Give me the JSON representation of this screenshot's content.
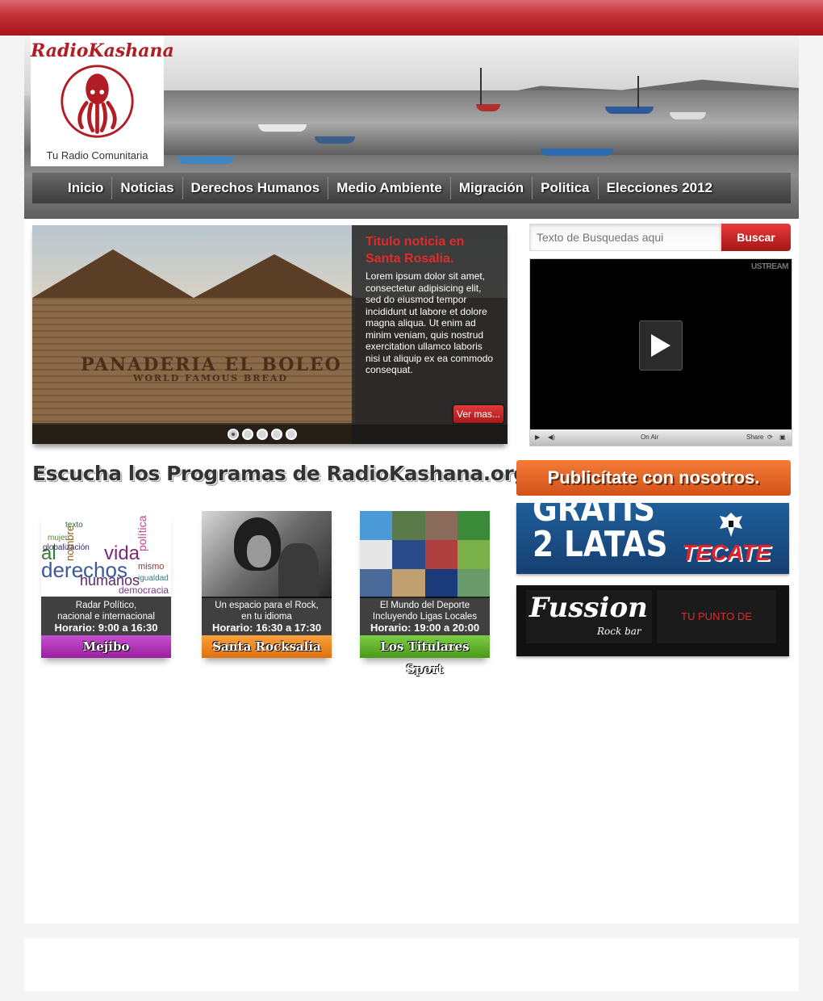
{
  "logo": {
    "title": "RadioKashana",
    "subtitle": "Tu Radio Comunitaria"
  },
  "nav": {
    "items": [
      {
        "label": "Inicio"
      },
      {
        "label": "Noticias"
      },
      {
        "label": "Derechos Humanos"
      },
      {
        "label": "Medio Ambiente"
      },
      {
        "label": "Migración"
      },
      {
        "label": "Politica"
      },
      {
        "label": "Elecciones 2012"
      }
    ]
  },
  "slider": {
    "title": "Titulo noticia en Santa Rosalia.",
    "text": "Lorem ipsum dolor sit amet, consectetur adipisicing elit, sed do eiusmod tempor incididunt ut labore et dolore magna aliqua. Ut enim ad minim veniam, quis nostrud exercitation ullamco laboris nisi ut aliquip ex ea commodo consequat.",
    "more_label": "Ver mas...",
    "photo_sign": "PANADERIA EL BOLEO",
    "photo_sign2": "WORLD FAMOUS BREAD",
    "dots": 5,
    "active_dot": 0
  },
  "search": {
    "placeholder": "Texto de Busquedas aqui",
    "button_label": "Buscar"
  },
  "player": {
    "brand": "USTREAM",
    "status": "On Air",
    "share_label": "Share"
  },
  "programs": {
    "heading": "Escucha los Programas de RadioKashana.org",
    "items": [
      {
        "line1": "Radar Político,",
        "line2": "nacional e internacional",
        "schedule": "Horario: 9:00 a 16:30",
        "label": "Mejibo",
        "color": "#b52fb8"
      },
      {
        "line1": "Un espacio para el Rock,",
        "line2": "en tu idioma",
        "schedule": "Horario: 16:30 a 17:30",
        "label": "Santa Rocksalia",
        "color": "#f08a1c"
      },
      {
        "line1": "El Mundo del Deporte",
        "line2": "Incluyendo Ligas Locales",
        "schedule": "Horario: 19:00 a 20:00",
        "label": "Los Titulares Sport",
        "color": "#5db32a"
      }
    ]
  },
  "ads": {
    "heading": "Publicítate con nosotros.",
    "ad1_text_a": "GRATIS",
    "ad1_text_b": "2 LATAS",
    "ad1_brand": "TECATE",
    "ad2_name": "Fussion",
    "ad2_sub": "Rock bar",
    "ad2_tag": "TU PUNTO DE ENCUENTRO"
  },
  "word_cloud": [
    "al",
    "vida",
    "política",
    "derechos",
    "humanos",
    "mujer",
    "globalización",
    "mismo",
    "igualdad",
    "democracia",
    "nombre",
    "texto"
  ]
}
